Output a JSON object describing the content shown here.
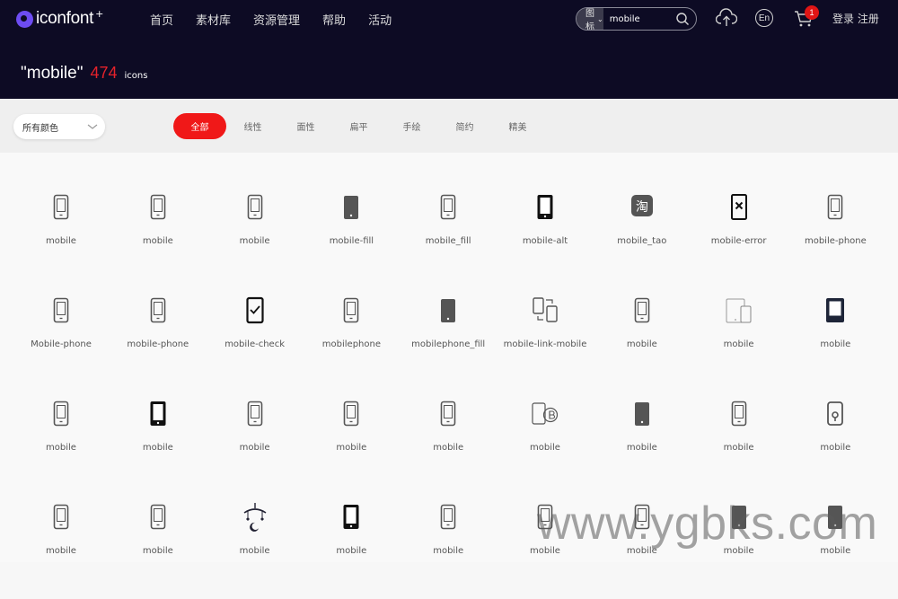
{
  "header": {
    "logo_text": "iconfont",
    "logo_plus": "+",
    "nav": [
      "首页",
      "素材库",
      "资源管理",
      "帮助",
      "活动"
    ],
    "search_type": "图标",
    "search_value": "mobile",
    "lang": "En",
    "cart_count": "1",
    "login": "登录",
    "register": "注册"
  },
  "search_result": {
    "query": "\"mobile\"",
    "count": "474",
    "unit": "icons"
  },
  "filters": {
    "color": "所有颜色",
    "tabs": [
      "全部",
      "线性",
      "面性",
      "扁平",
      "手绘",
      "简约",
      "精美"
    ],
    "active_tab": "全部"
  },
  "icons": [
    {
      "label": "mobile",
      "icon": "phone-outline-icon"
    },
    {
      "label": "mobile",
      "icon": "phone-outline-icon"
    },
    {
      "label": "mobile",
      "icon": "phone-outline-icon"
    },
    {
      "label": "mobile-fill",
      "icon": "phone-fill-icon"
    },
    {
      "label": "mobile_fill",
      "icon": "phone-outline-icon"
    },
    {
      "label": "mobile-alt",
      "icon": "phone-bold-icon"
    },
    {
      "label": "mobile_tao",
      "icon": "taobao-icon"
    },
    {
      "label": "mobile-error",
      "icon": "phone-error-icon"
    },
    {
      "label": "mobile-phone",
      "icon": "phone-outline-icon"
    },
    {
      "label": "Mobile-phone",
      "icon": "phone-outline-icon"
    },
    {
      "label": "mobile-phone",
      "icon": "phone-outline-icon"
    },
    {
      "label": "mobile-check",
      "icon": "phone-check-icon"
    },
    {
      "label": "mobilephone",
      "icon": "phone-outline-icon"
    },
    {
      "label": "mobilephone_fill",
      "icon": "phone-fill-icon"
    },
    {
      "label": "mobile-link-mobile",
      "icon": "phone-link-icon"
    },
    {
      "label": "mobile",
      "icon": "phone-outline-icon"
    },
    {
      "label": "mobile",
      "icon": "tablet-phone-icon"
    },
    {
      "label": "mobile",
      "icon": "phone-dark-icon"
    },
    {
      "label": "mobile",
      "icon": "phone-outline-icon"
    },
    {
      "label": "mobile",
      "icon": "phone-bold-icon"
    },
    {
      "label": "mobile",
      "icon": "phone-outline-icon"
    },
    {
      "label": "mobile",
      "icon": "phone-outline-icon"
    },
    {
      "label": "mobile",
      "icon": "phone-outline-icon"
    },
    {
      "label": "mobile",
      "icon": "phone-bitcoin-icon"
    },
    {
      "label": "mobile",
      "icon": "phone-fill-icon"
    },
    {
      "label": "mobile",
      "icon": "phone-outline-icon"
    },
    {
      "label": "mobile",
      "icon": "phone-pin-icon"
    },
    {
      "label": "mobile",
      "icon": "phone-outline-icon"
    },
    {
      "label": "mobile",
      "icon": "phone-outline-icon"
    },
    {
      "label": "mobile",
      "icon": "mobile-toy-icon"
    },
    {
      "label": "mobile",
      "icon": "phone-bold-icon"
    },
    {
      "label": "mobile",
      "icon": "phone-outline-icon"
    },
    {
      "label": "mobile",
      "icon": "phone-outline-icon"
    },
    {
      "label": "mobile",
      "icon": "phone-outline-icon"
    },
    {
      "label": "mobile",
      "icon": "phone-fill-icon"
    },
    {
      "label": "mobile",
      "icon": "phone-fill-icon"
    }
  ],
  "watermark": "www.ygbks.com"
}
